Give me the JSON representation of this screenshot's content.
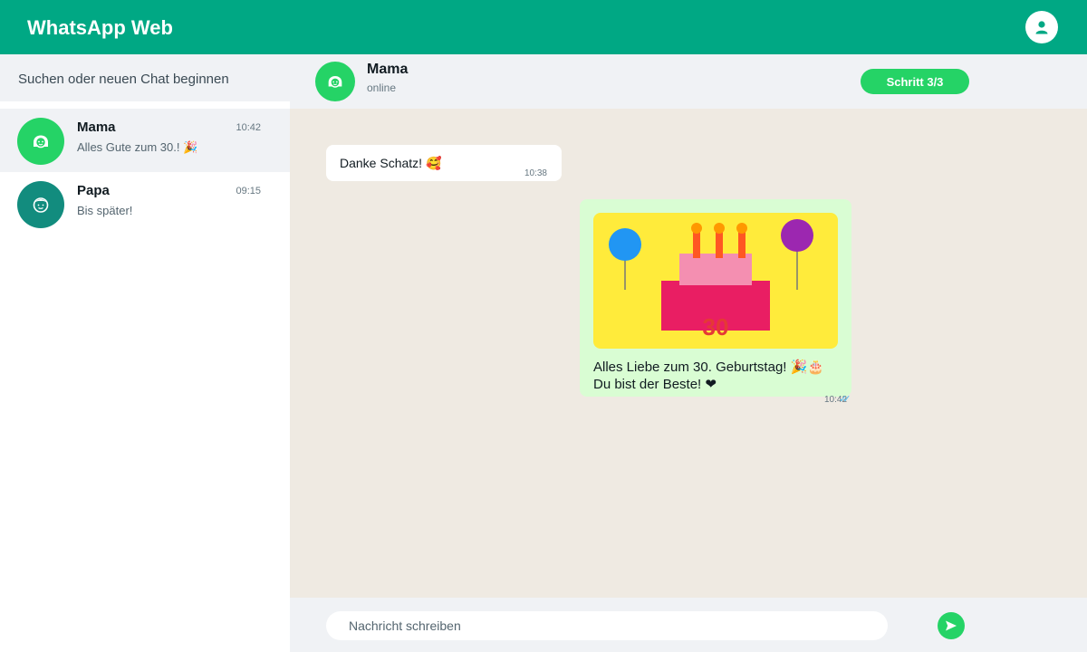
{
  "app": {
    "title": "WhatsApp Web"
  },
  "header": {
    "profile_icon": "user-icon"
  },
  "sidebar": {
    "search": {
      "placeholder": "Suchen oder neuen Chat beginnen",
      "value": ""
    },
    "chats": [
      {
        "name": "Mama",
        "time": "10:42",
        "preview": "Alles Gute zum 30.! 🎉",
        "avatar_color": "#25d366",
        "avatar_icon": "woman-face-icon",
        "active": true
      },
      {
        "name": "Papa",
        "time": "09:15",
        "preview": "Bis später!",
        "avatar_color": "#128c7e",
        "avatar_icon": "man-face-icon",
        "active": false
      }
    ]
  },
  "chat": {
    "contact": {
      "name": "Mama",
      "status": "online"
    },
    "step_label": "Schritt 3/3",
    "messages": [
      {
        "direction": "in",
        "text": "Danke Schatz! 🥰",
        "time": "10:38"
      },
      {
        "direction": "out",
        "image": "birthday-cake-card",
        "card_number": "30",
        "lines": [
          "Alles Liebe zum 30. Geburtstag! 🎉🎂",
          "Du bist der Beste! ❤"
        ],
        "time": "10:42",
        "status": "read"
      }
    ],
    "composer": {
      "placeholder": "Nachricht schreiben",
      "value": ""
    }
  },
  "colors": {
    "brand": "#00a884",
    "accent": "#25d366",
    "panel": "#f0f2f5",
    "chat_bg": "#efeae2",
    "outgoing_bubble": "#d9fdd3",
    "read_ticks": "#53bdeb"
  }
}
